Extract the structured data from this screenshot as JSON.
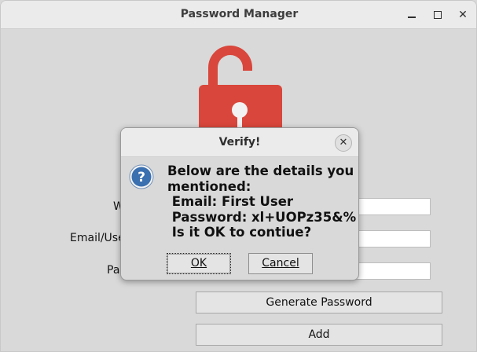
{
  "window": {
    "title": "Password Manager",
    "controls": {
      "minimize": "minimize",
      "maximize": "maximize",
      "close": "close"
    }
  },
  "form": {
    "website_label_partial": "W",
    "email_label_partial": "Email/Use",
    "password_label_partial": "Pa",
    "website_value": "",
    "email_value": "",
    "password_value": "",
    "generate_button": "Generate Password",
    "add_button": "Add"
  },
  "dialog": {
    "title": "Verify!",
    "message_lines": [
      "Below are the details you",
      "mentioned:",
      " Email: First User",
      " Password: xl+UOPz35&%",
      " Is it OK to contiue?"
    ],
    "ok_button": "OK",
    "cancel_button": "Cancel",
    "icon": "question-icon"
  },
  "colors": {
    "lock_red": "#d9463b",
    "dialog_icon_blue": "#3a6fb0"
  }
}
